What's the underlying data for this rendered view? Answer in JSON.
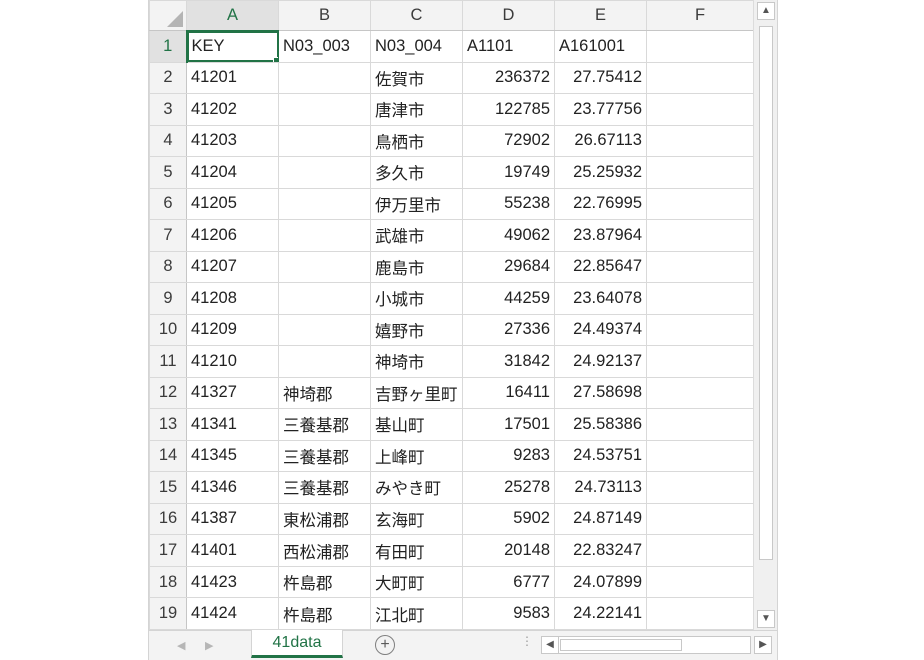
{
  "columns": [
    "A",
    "B",
    "C",
    "D",
    "E",
    "F"
  ],
  "rows": [
    {
      "n": "1",
      "a": "KEY",
      "b": "N03_003",
      "c": "N03_004",
      "d": "A1101",
      "e": "A161001"
    },
    {
      "n": "2",
      "a": "41201",
      "b": "",
      "c": "佐賀市",
      "d": "236372",
      "e": "27.75412"
    },
    {
      "n": "3",
      "a": "41202",
      "b": "",
      "c": "唐津市",
      "d": "122785",
      "e": "23.77756"
    },
    {
      "n": "4",
      "a": "41203",
      "b": "",
      "c": "鳥栖市",
      "d": "72902",
      "e": "26.67113"
    },
    {
      "n": "5",
      "a": "41204",
      "b": "",
      "c": "多久市",
      "d": "19749",
      "e": "25.25932"
    },
    {
      "n": "6",
      "a": "41205",
      "b": "",
      "c": "伊万里市",
      "d": "55238",
      "e": "22.76995"
    },
    {
      "n": "7",
      "a": "41206",
      "b": "",
      "c": "武雄市",
      "d": "49062",
      "e": "23.87964"
    },
    {
      "n": "8",
      "a": "41207",
      "b": "",
      "c": "鹿島市",
      "d": "29684",
      "e": "22.85647"
    },
    {
      "n": "9",
      "a": "41208",
      "b": "",
      "c": "小城市",
      "d": "44259",
      "e": "23.64078"
    },
    {
      "n": "10",
      "a": "41209",
      "b": "",
      "c": "嬉野市",
      "d": "27336",
      "e": "24.49374"
    },
    {
      "n": "11",
      "a": "41210",
      "b": "",
      "c": "神埼市",
      "d": "31842",
      "e": "24.92137"
    },
    {
      "n": "12",
      "a": "41327",
      "b": "神埼郡",
      "c": "吉野ヶ里町",
      "d": "16411",
      "e": "27.58698"
    },
    {
      "n": "13",
      "a": "41341",
      "b": "三養基郡",
      "c": "基山町",
      "d": "17501",
      "e": "25.58386"
    },
    {
      "n": "14",
      "a": "41345",
      "b": "三養基郡",
      "c": "上峰町",
      "d": "9283",
      "e": "24.53751"
    },
    {
      "n": "15",
      "a": "41346",
      "b": "三養基郡",
      "c": "みやき町",
      "d": "25278",
      "e": "24.73113"
    },
    {
      "n": "16",
      "a": "41387",
      "b": "東松浦郡",
      "c": "玄海町",
      "d": "5902",
      "e": "24.87149"
    },
    {
      "n": "17",
      "a": "41401",
      "b": "西松浦郡",
      "c": "有田町",
      "d": "20148",
      "e": "22.83247"
    },
    {
      "n": "18",
      "a": "41423",
      "b": "杵島郡",
      "c": "大町町",
      "d": "6777",
      "e": "24.07899"
    },
    {
      "n": "19",
      "a": "41424",
      "b": "杵島郡",
      "c": "江北町",
      "d": "9583",
      "e": "24.22141"
    }
  ],
  "sheet_tab": "41data",
  "add_sheet_symbol": "+",
  "icons": {
    "scroll_up": "▲",
    "scroll_down": "▼",
    "scroll_left": "◀",
    "scroll_right": "▶",
    "nav_prev": "◀",
    "nav_next": "▶",
    "split_dots": "⋮"
  },
  "colors": {
    "accent": "#217346",
    "header_bg": "#f3f3f3",
    "gridline": "#d9d9d9"
  }
}
